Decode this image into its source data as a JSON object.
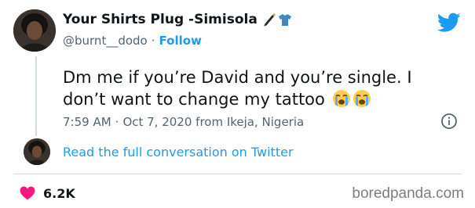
{
  "tweet": {
    "display_name": "Your Shirts Plug -Simisola",
    "name_emoji": [
      "pen-icon",
      "tshirt-icon"
    ],
    "handle": "@burnt__dodo",
    "separator": "·",
    "follow_label": "Follow",
    "text_line1": "Dm me if you’re David and you’re single. I",
    "text_line2": "don’t want to change my tattoo",
    "text_emoji": [
      "loudly-crying-face-icon",
      "loudly-crying-face-icon"
    ],
    "time": "7:59 AM",
    "date_location": "Oct 7, 2020 from Ikeja, Nigeria",
    "read_more_label": "Read the full conversation on Twitter",
    "like_count": "6.2K"
  },
  "watermark": "boredpanda.com",
  "colors": {
    "accent": "#1d9bf0",
    "like": "#f91880",
    "text": "#0f1419",
    "muted": "#536471"
  }
}
